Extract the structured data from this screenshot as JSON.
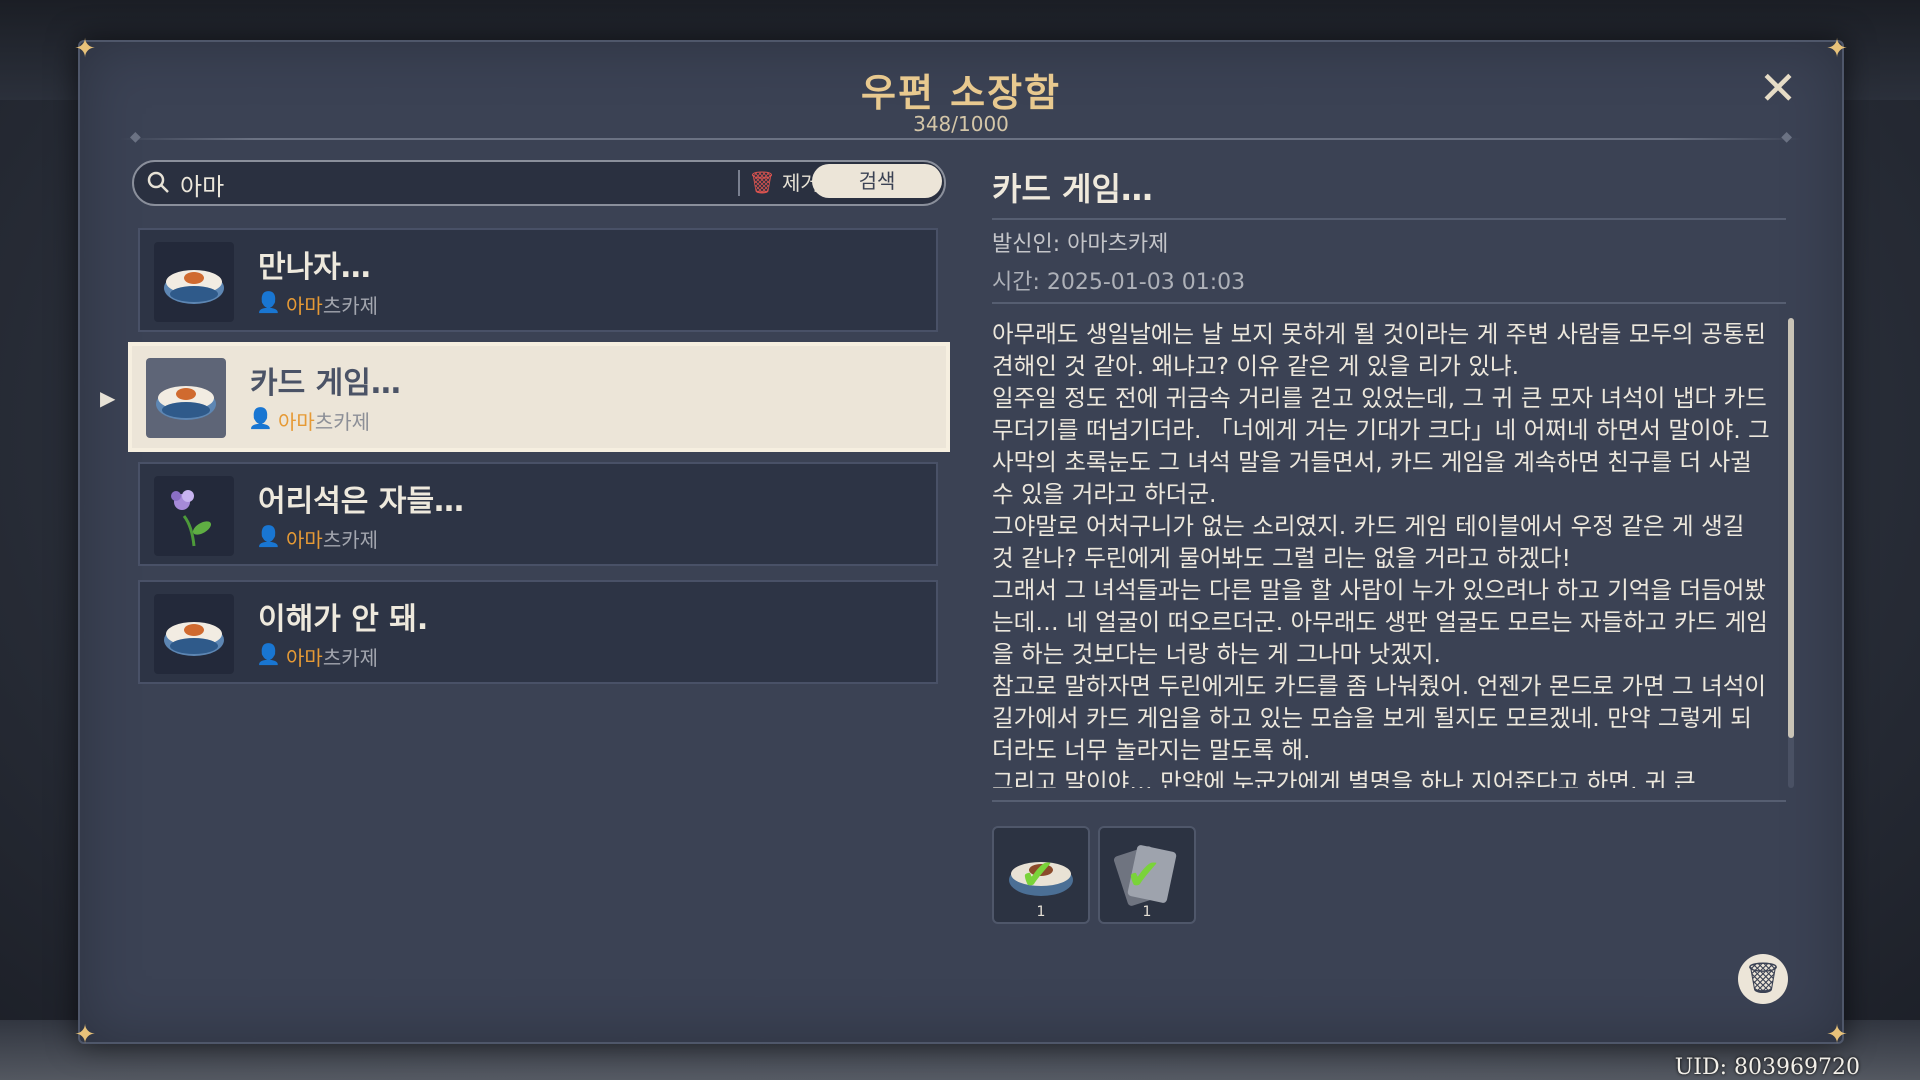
{
  "window": {
    "title": "우편 소장함",
    "count": "348/1000"
  },
  "search": {
    "value": "아마",
    "clear_label": "제거",
    "search_label": "검색"
  },
  "mails": [
    {
      "title": "만나자…",
      "sender_highlight": "아마",
      "sender_rest": "츠카제",
      "icon": "rice-bowl-icon"
    },
    {
      "title": "카드 게임…",
      "sender_highlight": "아마",
      "sender_rest": "츠카제",
      "icon": "rice-bowl-icon"
    },
    {
      "title": "어리석은 자들…",
      "sender_highlight": "아마",
      "sender_rest": "츠카제",
      "icon": "flower-icon"
    },
    {
      "title": "이해가 안 돼.",
      "sender_highlight": "아마",
      "sender_rest": "츠카제",
      "icon": "rice-bowl-icon"
    }
  ],
  "detail": {
    "title": "카드 게임…",
    "sender": "발신인: 아마츠카제",
    "time": "시간: 2025-01-03 01:03",
    "body": [
      "아무래도 생일날에는 날 보지 못하게 될 것이라는 게 주변 사람들 모두의 공통된 견해인 것 같아. 왜냐고? 이유 같은 게 있을 리가 있냐.",
      "일주일 정도 전에 귀금속 거리를 걷고 있었는데, 그 귀 큰 모자 녀석이 냅다 카드 무더기를 떠넘기더라. 「너에게 거는 기대가 크다」네 어쩌네 하면서 말이야. 그 사막의 초록눈도 그 녀석 말을 거들면서, 카드 게임을 계속하면 친구를 더 사귈 수 있을 거라고 하더군.",
      "그야말로 어처구니가 없는 소리였지. 카드 게임 테이블에서 우정 같은 게 생길 것 같나? 두린에게 물어봐도 그럴 리는 없을 거라고 하겠다!",
      "그래서 그 녀석들과는 다른 말을 할 사람이 누가 있으려나 하고 기억을 더듬어봤는데… 네 얼굴이 떠오르더군. 아무래도 생판 얼굴도 모르는 자들하고 카드 게임을 하는 것보다는 너랑 하는 게 그나마 낫겠지.",
      "참고로 말하자면 두린에게도 카드를 좀 나눠줬어. 언젠가 몬드로 가면 그 녀석이 길가에서 카드 게임을 하고 있는 모습을 보게 될지도 모르겠네. 만약 그렇게 되더라도 너무 놀라지는 말도록 해.",
      "그리고 말이야… 만약에 누군가에게 별명을 하나 지어준다고 하면, 귀 큰"
    ]
  },
  "attachments": [
    {
      "icon": "rice-bowl-icon",
      "qty": "1"
    },
    {
      "icon": "card-deck-icon",
      "qty": "1"
    }
  ],
  "uid": "UID: 803969720"
}
